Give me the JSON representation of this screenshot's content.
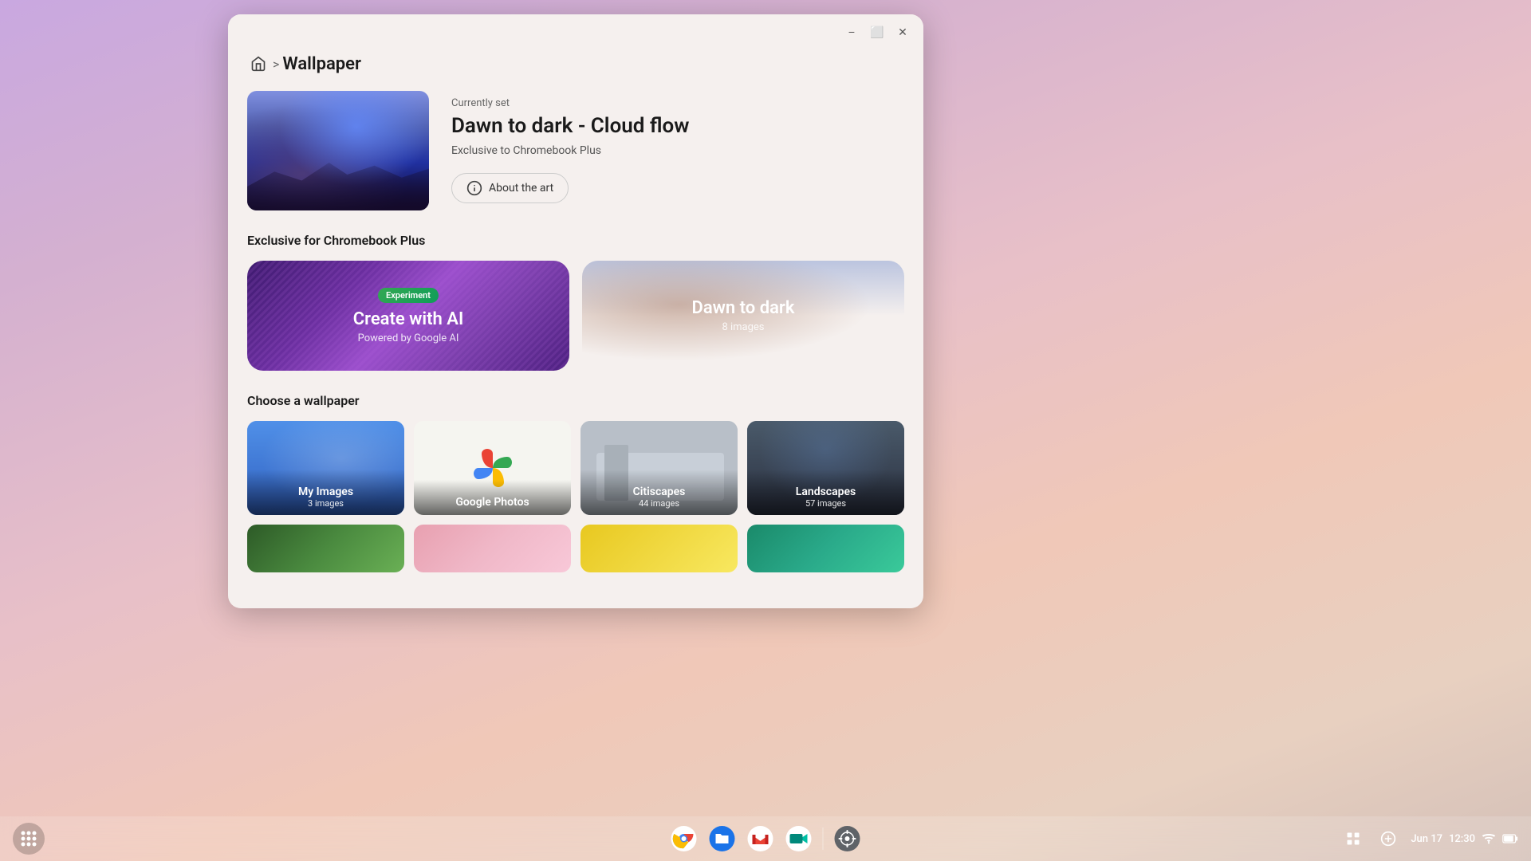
{
  "desktop": {
    "background": "gradient pink purple"
  },
  "window": {
    "title": "Wallpaper",
    "buttons": {
      "minimize": "−",
      "maximize": "⬜",
      "close": "✕"
    }
  },
  "breadcrumb": {
    "home_label": "Home",
    "arrow": ">",
    "current": "Wallpaper"
  },
  "current_wallpaper": {
    "label": "Currently set",
    "name": "Dawn to dark - Cloud flow",
    "exclusive": "Exclusive to Chromebook Plus",
    "about_btn": "About the art"
  },
  "chromebook_plus": {
    "section_title": "Exclusive for Chromebook Plus",
    "cards": [
      {
        "badge": "Experiment",
        "title": "Create with AI",
        "subtitle": "Powered by Google AI"
      },
      {
        "title": "Dawn to dark",
        "subtitle": "8 images"
      }
    ]
  },
  "choose_wallpaper": {
    "section_title": "Choose a wallpaper",
    "tiles": [
      {
        "name": "My Images",
        "count": "3 images",
        "type": "my-images"
      },
      {
        "name": "Google Photos",
        "count": "",
        "type": "google-photos"
      },
      {
        "name": "Citiscapes",
        "count": "44 images",
        "type": "citiscapes"
      },
      {
        "name": "Landscapes",
        "count": "57 images",
        "type": "landscapes"
      }
    ]
  },
  "taskbar": {
    "launcher_icon": "⊙",
    "apps": [
      {
        "name": "Chrome",
        "type": "chrome"
      },
      {
        "name": "Files",
        "type": "files"
      },
      {
        "name": "Gmail",
        "type": "gmail"
      },
      {
        "name": "Google Meet",
        "type": "meet"
      },
      {
        "name": "Wallpaper",
        "type": "wallpaper"
      }
    ],
    "status": {
      "date": "Jun 17",
      "time": "12:30"
    }
  }
}
